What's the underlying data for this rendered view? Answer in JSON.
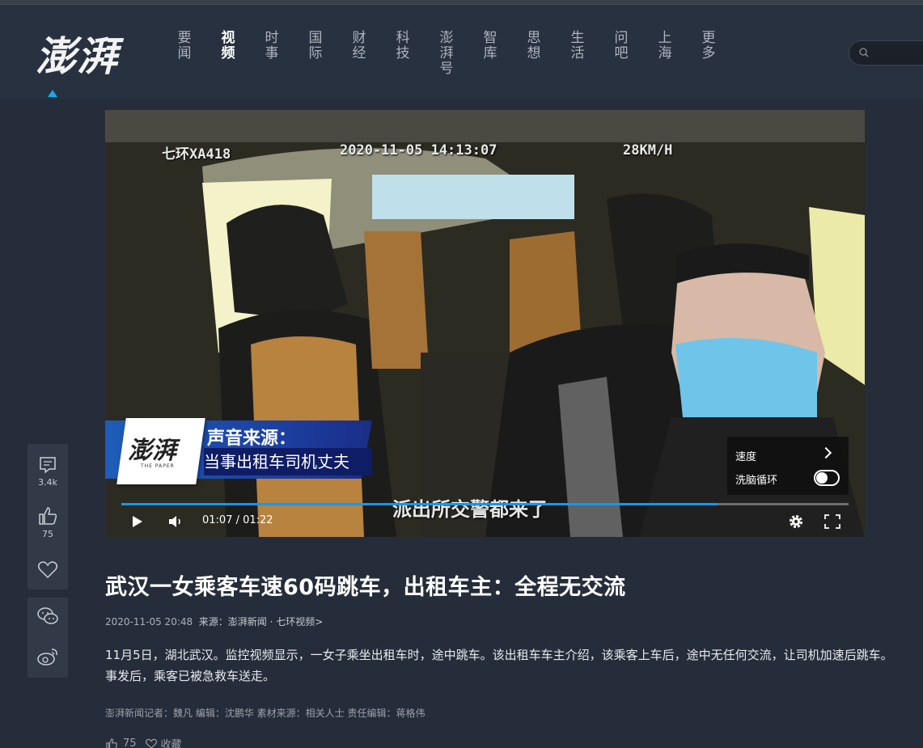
{
  "header": {
    "logo_text": "澎湃",
    "nav": [
      {
        "label": "要闻",
        "active": false
      },
      {
        "label": "视频",
        "active": true
      },
      {
        "label": "时事",
        "active": false
      },
      {
        "label": "国际",
        "active": false
      },
      {
        "label": "财经",
        "active": false
      },
      {
        "label": "科技",
        "active": false
      },
      {
        "label": "澎湃号",
        "active": false
      },
      {
        "label": "智库",
        "active": false
      },
      {
        "label": "思想",
        "active": false
      },
      {
        "label": "生活",
        "active": false
      },
      {
        "label": "问吧",
        "active": false
      },
      {
        "label": "上海",
        "active": false
      },
      {
        "label": "更多",
        "active": false
      }
    ],
    "search_placeholder": ""
  },
  "video": {
    "osd_id": "七环XA418",
    "osd_timestamp": "2020-11-05 14:13:07",
    "osd_speed": "28KM/H",
    "banner_logo": "澎湃",
    "banner_logo_sub": "THE PAPER",
    "banner_title": "声音来源：",
    "banner_sub": "当事出租车司机丈夫",
    "subtitle": "派出所交警都来了",
    "menu": {
      "speed_label": "速度",
      "loop_label": "洗脑循环",
      "loop_on": false
    },
    "current_time": "01:07",
    "duration": "01:22",
    "time_display": "01:07 / 01:22",
    "progress": 0.82,
    "accent_color": "#1896e8"
  },
  "sidebar": {
    "comments_count": "3.4k",
    "likes_count": "75"
  },
  "article": {
    "title": "武汉一女乘客车速60码跳车，出租车主：全程无交流",
    "datetime": "2020-11-05 20:48",
    "source_label": "来源：澎湃新闻 · 七环视频>",
    "body": "11月5日，湖北武汉。监控视频显示，一女子乘坐出租车时，途中跳车。该出租车车主介绍，该乘客上车后，途中无任何交流，让司机加速后跳车。事发后，乘客已被急救车送走。",
    "credits": "澎湃新闻记者：魏凡 编辑：沈鹏华 素材来源：相关人士  责任编辑：蒋格伟",
    "bottom_likes": "75",
    "bottom_collect": "收藏"
  }
}
